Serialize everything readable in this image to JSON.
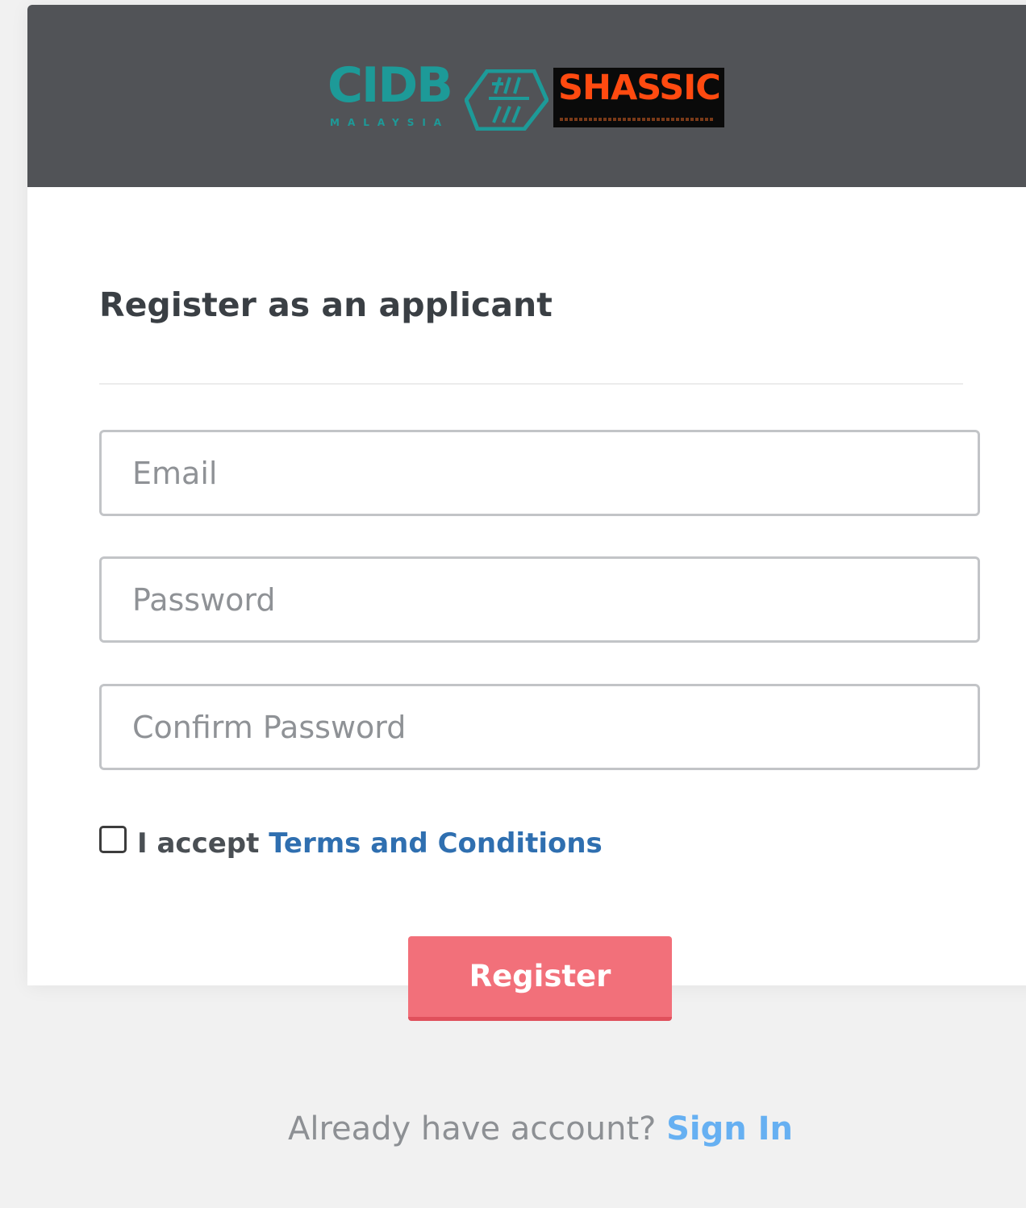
{
  "header": {
    "brand_colors": {
      "header_bg": "#515357",
      "cidb": "#1d9a98",
      "shassic": "#ff4a10"
    },
    "logos": {
      "cidb": "CIDB",
      "cidb_sub": "MALAYSIA",
      "shassic": "SHASSIC"
    }
  },
  "form": {
    "title": "Register as an applicant",
    "email": {
      "placeholder": "Email",
      "value": ""
    },
    "password": {
      "placeholder": "Password",
      "value": ""
    },
    "confirm_password": {
      "placeholder": "Confirm Password",
      "value": ""
    },
    "terms": {
      "checked": false,
      "prefix": "I accept",
      "link_label": "Terms and Conditions"
    },
    "submit_label": "Register"
  },
  "footer": {
    "question": "Already have account?",
    "link_label": "Sign In"
  },
  "colors": {
    "accent_button": "#f2707a",
    "link_terms": "#2f6fb0",
    "link_signin": "#66b0f2"
  }
}
